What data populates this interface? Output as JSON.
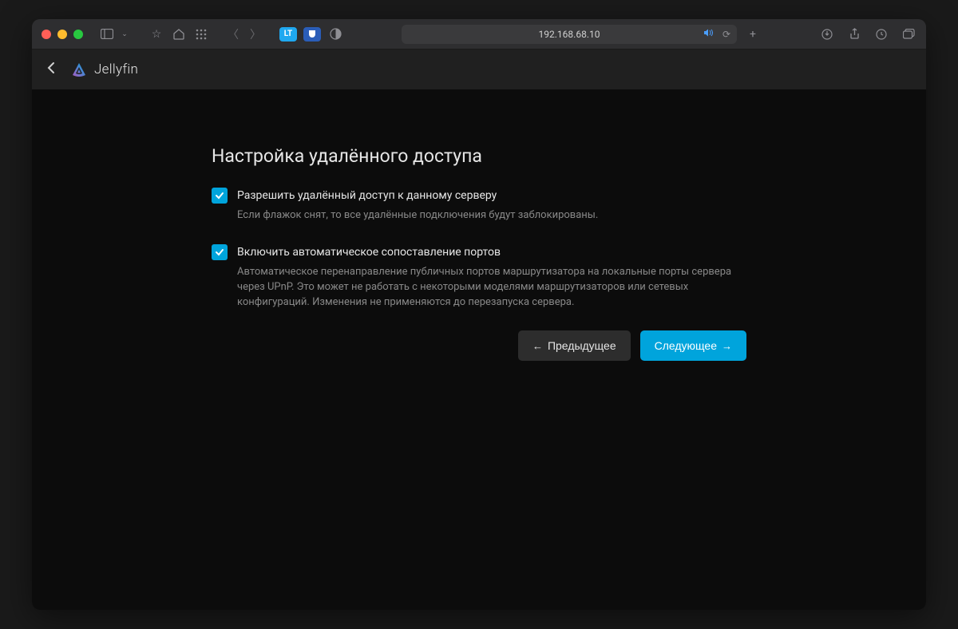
{
  "browser": {
    "url": "192.168.68.10"
  },
  "header": {
    "app_name": "Jellyfin"
  },
  "wizard": {
    "title": "Настройка удалённого доступа",
    "option1": {
      "label": "Разрешить удалённый доступ к данному серверу",
      "help": "Если флажок снят, то все удалённые подключения будут заблокированы."
    },
    "option2": {
      "label": "Включить автоматическое сопоставление портов",
      "help": "Автоматическое перенаправление публичных портов маршрутизатора на локальные порты сервера через UPnP. Это может не работать с некоторыми моделями маршрутизаторов или сетевых конфигураций. Изменения не применяются до перезапуска сервера."
    },
    "prev_label": "Предыдущее",
    "next_label": "Следующее"
  }
}
